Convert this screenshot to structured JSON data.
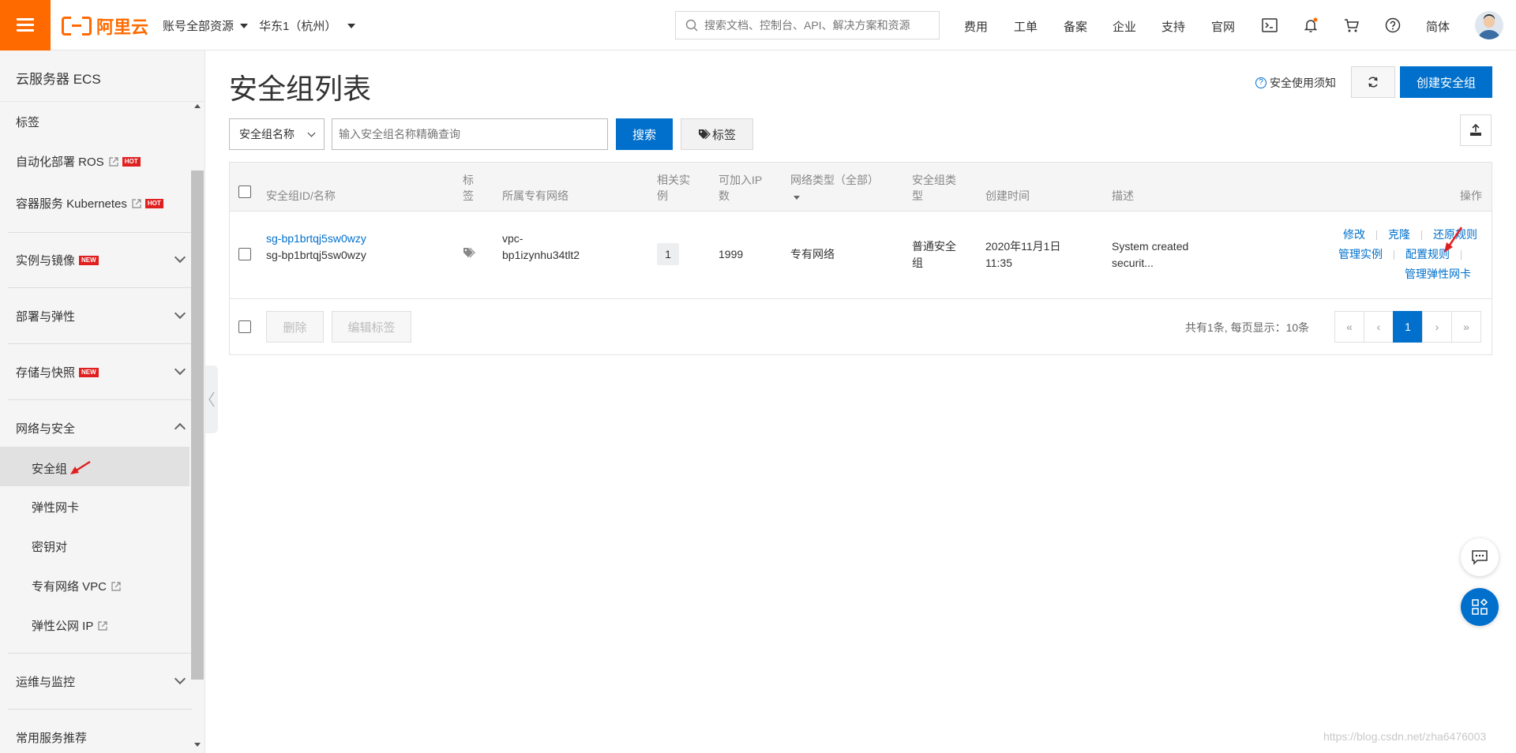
{
  "colors": {
    "brand": "#ff6a00",
    "primary": "#0070cc",
    "badge_red": "#e02020"
  },
  "topbar": {
    "logo_text": "阿里云",
    "account_scope": "账号全部资源",
    "region": "华东1（杭州）",
    "search_placeholder": "搜索文档、控制台、API、解决方案和资源",
    "nav": [
      "费用",
      "工单",
      "备案",
      "企业",
      "支持",
      "官网"
    ],
    "icons": [
      "terminal-icon",
      "bell-icon",
      "cart-icon",
      "help-icon"
    ],
    "language": "简体"
  },
  "sidebar": {
    "title": "云服务器 ECS",
    "items": [
      {
        "label": "标签"
      },
      {
        "label": "自动化部署 ROS",
        "badge": "HOT",
        "external": true
      },
      {
        "label": "容器服务 Kubernetes",
        "badge": "HOT",
        "external": true
      }
    ],
    "groups": [
      {
        "label": "实例与镜像",
        "badge": "NEW"
      },
      {
        "label": "部署与弹性"
      },
      {
        "label": "存储与快照",
        "badge": "NEW"
      },
      {
        "label": "网络与安全",
        "expanded": true
      }
    ],
    "network_items": [
      {
        "label": "安全组",
        "active": true
      },
      {
        "label": "弹性网卡"
      },
      {
        "label": "密钥对"
      },
      {
        "label": "专有网络 VPC",
        "external": true
      },
      {
        "label": "弹性公网 IP",
        "external": true
      }
    ],
    "bottom_groups": [
      {
        "label": "运维与监控"
      },
      {
        "label": "常用服务推荐"
      }
    ]
  },
  "main": {
    "title": "安全组列表",
    "help_link": "安全使用须知",
    "create_button": "创建安全组",
    "filter_select": "安全组名称",
    "filter_placeholder": "输入安全组名称精确查询",
    "search_button": "搜索",
    "tag_button": "标签"
  },
  "table": {
    "headers": {
      "id_name": "安全组ID/名称",
      "tag": "标\n签",
      "vpc": "所属专有网络",
      "instances": "相关实\n例",
      "available_ip": "可加入IP\n数",
      "network_type": "网络类型（全部）",
      "sg_type": "安全组类\n型",
      "created": "创建时间",
      "description": "描述",
      "actions": "操作"
    },
    "rows": [
      {
        "id": "sg-bp1brtqj5sw0wzy",
        "name": "sg-bp1brtqj5sw0wzy",
        "vpc_line1": "vpc-",
        "vpc_line2": "bp1izynhu34tlt2",
        "instances": "1",
        "available_ip": "1999",
        "network_type": "专有网络",
        "sg_type_line1": "普通安全",
        "sg_type_line2": "组",
        "created_line1": "2020年11月1日",
        "created_line2": "11:35",
        "desc_line1": "System created",
        "desc_line2": "securit...",
        "actions": {
          "modify": "修改",
          "clone": "克隆",
          "restore": "还原规则",
          "manage_instances": "管理实例",
          "configure_rules": "配置规则",
          "manage_eni": "管理弹性网卡"
        }
      }
    ],
    "footer": {
      "delete": "删除",
      "edit_tags": "编辑标签",
      "page_info": "共有1条, 每页显示：10条",
      "pager": [
        "«",
        "‹",
        "1",
        "›",
        "»"
      ],
      "current_page": "1"
    }
  },
  "watermark": "https://blog.csdn.net/zha6476003"
}
